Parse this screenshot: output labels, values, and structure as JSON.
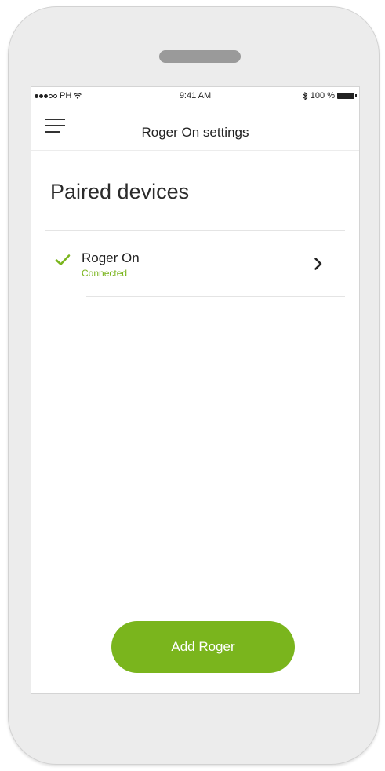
{
  "status_bar": {
    "carrier": "PH",
    "time": "9:41 AM",
    "battery": "100 %"
  },
  "nav": {
    "title": "Roger On settings"
  },
  "main": {
    "heading": "Paired devices",
    "devices": [
      {
        "name": "Roger On",
        "status": "Connected"
      }
    ],
    "add_button_label": "Add Roger"
  },
  "colors": {
    "accent": "#7ab51d",
    "text": "#222222",
    "frame": "#ececec"
  },
  "icons": {
    "menu": "hamburger-menu-icon",
    "status": "check-icon",
    "row_action": "chevron-right-icon"
  }
}
